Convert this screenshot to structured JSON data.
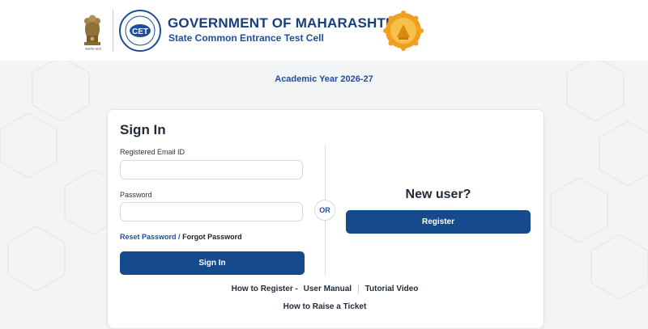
{
  "header": {
    "title": "GOVERNMENT OF MAHARASHTRA",
    "subtitle": "State Common Entrance Test Cell",
    "emblem_caption": "सत्यमेव जयते",
    "cet_logo_text": "CET"
  },
  "academic_year": "Academic Year 2026-27",
  "signin": {
    "title": "Sign In",
    "email_label": "Registered Email ID",
    "email_value": "",
    "password_label": "Password",
    "password_value": "",
    "reset_link": "Reset Password",
    "slash": "/",
    "forgot_link": "Forgot Password",
    "button": "Sign In"
  },
  "or_label": "OR",
  "new_user": {
    "title": "New user?",
    "button": "Register"
  },
  "help_links": {
    "how_to_register": "How to Register -",
    "user_manual": "User Manual",
    "tutorial_video": "Tutorial Video",
    "raise_ticket": "How to Raise a Ticket"
  },
  "colors": {
    "primary": "#154a8c",
    "heading_blue": "#173f7a",
    "seal_orange": "#f0a020"
  }
}
